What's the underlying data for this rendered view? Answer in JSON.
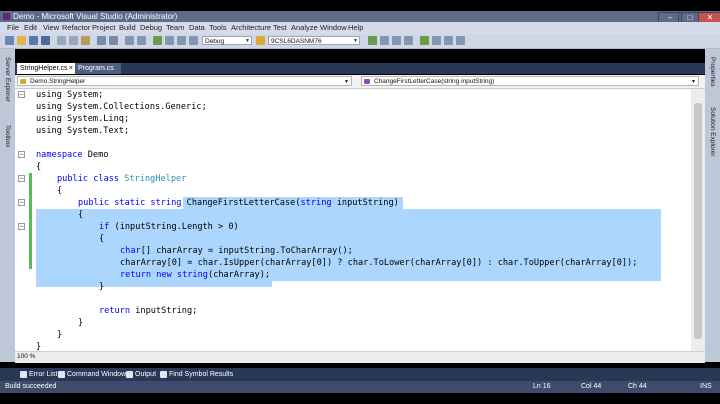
{
  "titlebar": {
    "title": "Demo - Microsoft Visual Studio (Administrator)",
    "minimize": "–",
    "maximize": "□",
    "close": "✕"
  },
  "menu": [
    "File",
    "Edit",
    "View",
    "Refactor",
    "Project",
    "Build",
    "Debug",
    "Team",
    "Data",
    "Tools",
    "Architecture",
    "Test",
    "Analyze",
    "Window",
    "Help"
  ],
  "toolbar": {
    "config": "Debug",
    "platform": "9CSL6DASNM76"
  },
  "left_side_tabs": [
    "Server Explorer",
    "Toolbox"
  ],
  "right_side_tabs": [
    "Properties",
    "Solution Explorer"
  ],
  "tabs": [
    {
      "label": "StringHelper.cs",
      "close": "×"
    },
    {
      "label": "Program.cs"
    }
  ],
  "navbar": {
    "class": "Demo.StringHelper",
    "member": "ChangeFirstLetterCase(string inputString)"
  },
  "code": {
    "line1": "using System;",
    "line2": "using System.Collections.Generic;",
    "line3": "using System.Linq;",
    "line4": "using System.Text;",
    "line6_kw": "namespace",
    "line6_rest": " Demo",
    "line7": "{",
    "line8_kw": "public class",
    "line8_type": "StringHelper",
    "line9": "{",
    "line10_kw1": "public static string",
    "line10_name": "ChangeFirstLetterCase(",
    "line10_kw2": "string",
    "line10_rest": " inputString)",
    "line11": "{",
    "line12_kw": "if",
    "line12_rest": " (inputString.Length > 0)",
    "line13": "{",
    "line14_kw": "char",
    "line14_rest": "[] charArray = inputString.ToCharArray();",
    "line15": "charArray[0] = char.IsUpper(charArray[0]) ? char.ToLower(charArray[0]) : char.ToUpper(charArray[0]);",
    "line16_kw": "return new string",
    "line16_rest": "(charArray);",
    "line17": "}",
    "line19_kw": "return",
    "line19_rest": " inputString;",
    "line20": "}",
    "line21": "}",
    "line22": "}"
  },
  "zoom": "100 %",
  "bottom_tabs": [
    "Error List",
    "Command Window",
    "Output",
    "Find Symbol Results"
  ],
  "status": {
    "message": "Build succeeded",
    "ln": "Ln 16",
    "col": "Col 44",
    "ch": "Ch 44",
    "mode": "INS"
  }
}
